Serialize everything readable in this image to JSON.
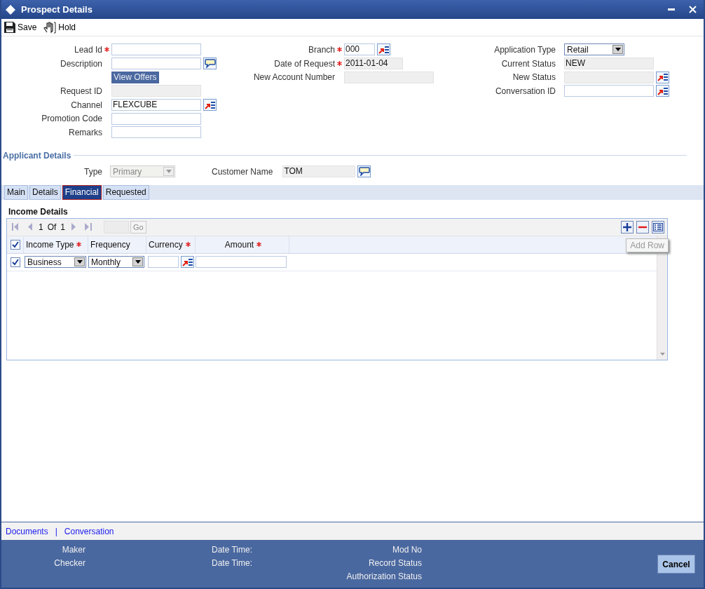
{
  "window": {
    "title": "Prospect Details"
  },
  "toolbar": [
    {
      "kind": "save",
      "label": "Save"
    },
    {
      "kind": "hold",
      "label": "Hold"
    }
  ],
  "form": {
    "left": [
      {
        "label": "Lead Id",
        "required": true,
        "kind": "input",
        "lookup": false,
        "comment": false
      },
      {
        "label": "Description",
        "required": false,
        "kind": "input",
        "lookup": false,
        "comment": true
      },
      {
        "kind": "button",
        "value": "View Offers"
      },
      {
        "label": "Request ID",
        "required": false,
        "kind": "readonly",
        "lookup": false,
        "comment": false
      },
      {
        "label": "Channel",
        "required": false,
        "kind": "input",
        "value": "FLEXCUBE",
        "lookup": true,
        "comment": false
      },
      {
        "label": "Promotion Code",
        "required": false,
        "kind": "input",
        "lookup": false,
        "comment": false
      },
      {
        "label": "Remarks",
        "required": false,
        "kind": "input",
        "lookup": false,
        "comment": false
      }
    ],
    "middle": [
      {
        "label": "Branch",
        "required": true,
        "kind": "input",
        "value": "000",
        "lookup": true,
        "comment": false
      },
      {
        "label": "Date of Request",
        "required": true,
        "kind": "readonly",
        "value": "2011-01-04",
        "lookup": false,
        "comment": false
      },
      {
        "label": "New Account Number",
        "required": false,
        "kind": "readonly",
        "lookup": false,
        "comment": false
      }
    ],
    "right": [
      {
        "label": "Application Type",
        "required": false,
        "kind": "select",
        "value": "Retail",
        "lookup": false,
        "comment": false
      },
      {
        "label": "Current Status",
        "required": false,
        "kind": "readonly",
        "value": "NEW",
        "lookup": false,
        "comment": false
      },
      {
        "label": "New Status",
        "required": false,
        "kind": "readonly",
        "lookup": true,
        "comment": false
      },
      {
        "label": "Conversation ID",
        "required": false,
        "kind": "input",
        "lookup": true,
        "comment": false
      }
    ]
  },
  "applicant_details": {
    "title": "Applicant Details",
    "fields": [
      {
        "label": "Type",
        "kind": "select",
        "value": "Primary",
        "disabled": true,
        "lookup": false,
        "comment": false
      },
      {
        "label": "Customer Name",
        "kind": "readonly",
        "value": "TOM",
        "disabled": false,
        "lookup": false,
        "comment": true
      }
    ]
  },
  "tabs": [
    {
      "label": "Main",
      "selected": false
    },
    {
      "label": "Details",
      "selected": false
    },
    {
      "label": "Financial",
      "selected": true
    },
    {
      "label": "Requested",
      "selected": false
    }
  ],
  "income_details": {
    "title": "Income Details",
    "pager": {
      "page": "1",
      "of": "Of",
      "total": "1",
      "go": {
        "label": "Go",
        "disabled": true
      }
    },
    "tooltip": "Add Row",
    "header_checked": true,
    "columns": [
      {
        "label": "Income Type",
        "required": true
      },
      {
        "label": "Frequency",
        "required": false
      },
      {
        "label": "Currency",
        "required": true
      },
      {
        "label": "Amount",
        "required": true
      }
    ],
    "rows": [
      {
        "checked": true,
        "cells": [
          {
            "kind": "select",
            "value": "Business",
            "lookup": false
          },
          {
            "kind": "select",
            "value": "Monthly",
            "lookup": false
          },
          {
            "kind": "input",
            "lookup": true
          },
          {
            "kind": "input",
            "lookup": false
          }
        ]
      }
    ]
  },
  "footer": {
    "links": [
      {
        "label": "Documents"
      },
      {
        "label": "Conversation"
      }
    ],
    "separator": "|",
    "info": [
      {
        "items": [
          "Maker",
          "Checker"
        ]
      },
      {
        "items": [
          "Date Time:",
          "Date Time:"
        ]
      },
      {
        "items": [
          "Mod No",
          "Record Status",
          "Authorization Status"
        ]
      }
    ],
    "cancel": "Cancel"
  }
}
